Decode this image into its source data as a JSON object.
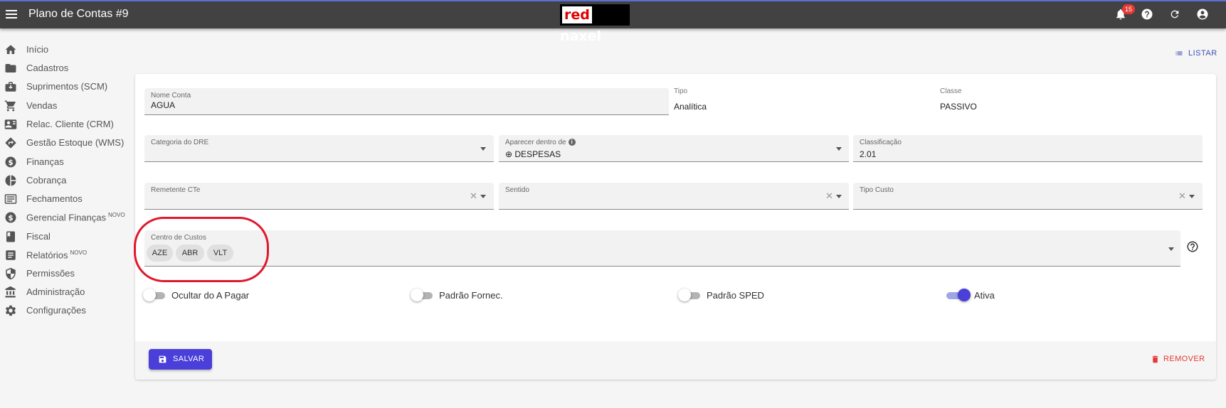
{
  "header": {
    "title": "Plano de Contas #9",
    "logo_red": "red",
    "logo_rest": "naxel",
    "notification_count": "15"
  },
  "sidebar": {
    "items": [
      {
        "label": "Início",
        "icon": "home-icon"
      },
      {
        "label": "Cadastros",
        "icon": "folder-icon"
      },
      {
        "label": "Suprimentos (SCM)",
        "icon": "briefcase-icon"
      },
      {
        "label": "Vendas",
        "icon": "cart-icon"
      },
      {
        "label": "Relac. Cliente (CRM)",
        "icon": "contact-card-icon"
      },
      {
        "label": "Gestão Estoque (WMS)",
        "icon": "directions-icon"
      },
      {
        "label": "Finanças",
        "icon": "dollar-circle-icon"
      },
      {
        "label": "Cobrança",
        "icon": "pie-chart-icon"
      },
      {
        "label": "Fechamentos",
        "icon": "list-box-icon"
      },
      {
        "label": "Gerencial Finanças",
        "badge": "NOVO",
        "icon": "dollar-circle-icon"
      },
      {
        "label": "Fiscal",
        "icon": "book-icon"
      },
      {
        "label": "Relatórios",
        "badge": "NOVO",
        "icon": "report-icon"
      },
      {
        "label": "Permissões",
        "icon": "shield-icon"
      },
      {
        "label": "Administração",
        "icon": "bank-icon"
      },
      {
        "label": "Configurações",
        "icon": "gear-icon"
      }
    ]
  },
  "actions": {
    "list_label": "LISTAR",
    "save_label": "SALVAR",
    "remove_label": "REMOVER"
  },
  "form": {
    "nome_conta": {
      "label": "Nome Conta",
      "value": "AGUA"
    },
    "tipo": {
      "label": "Tipo",
      "value": "Analítica"
    },
    "classe": {
      "label": "Classe",
      "value": "PASSIVO"
    },
    "categoria_dre": {
      "label": "Categoria do DRE",
      "value": ""
    },
    "aparecer_dentro": {
      "label": "Aparecer dentro de",
      "value": "⊕ DESPESAS"
    },
    "classificacao": {
      "label": "Classificação",
      "value": "2.01"
    },
    "remetente_cte": {
      "label": "Remetente CTe",
      "value": ""
    },
    "sentido": {
      "label": "Sentido",
      "value": ""
    },
    "tipo_custo": {
      "label": "Tipo Custo",
      "value": ""
    },
    "centro_custos": {
      "label": "Centro de Custos",
      "chips": [
        "AZE",
        "ABR",
        "VLT"
      ]
    }
  },
  "toggles": [
    {
      "label": "Ocultar do A Pagar",
      "on": false
    },
    {
      "label": "Padrão Fornec.",
      "on": false
    },
    {
      "label": "Padrão SPED",
      "on": false
    },
    {
      "label": "Ativa",
      "on": true
    }
  ],
  "colors": {
    "primary": "#4a3fd8",
    "topbar": "#424242",
    "danger": "#e53935",
    "highlight": "#e0182d"
  }
}
